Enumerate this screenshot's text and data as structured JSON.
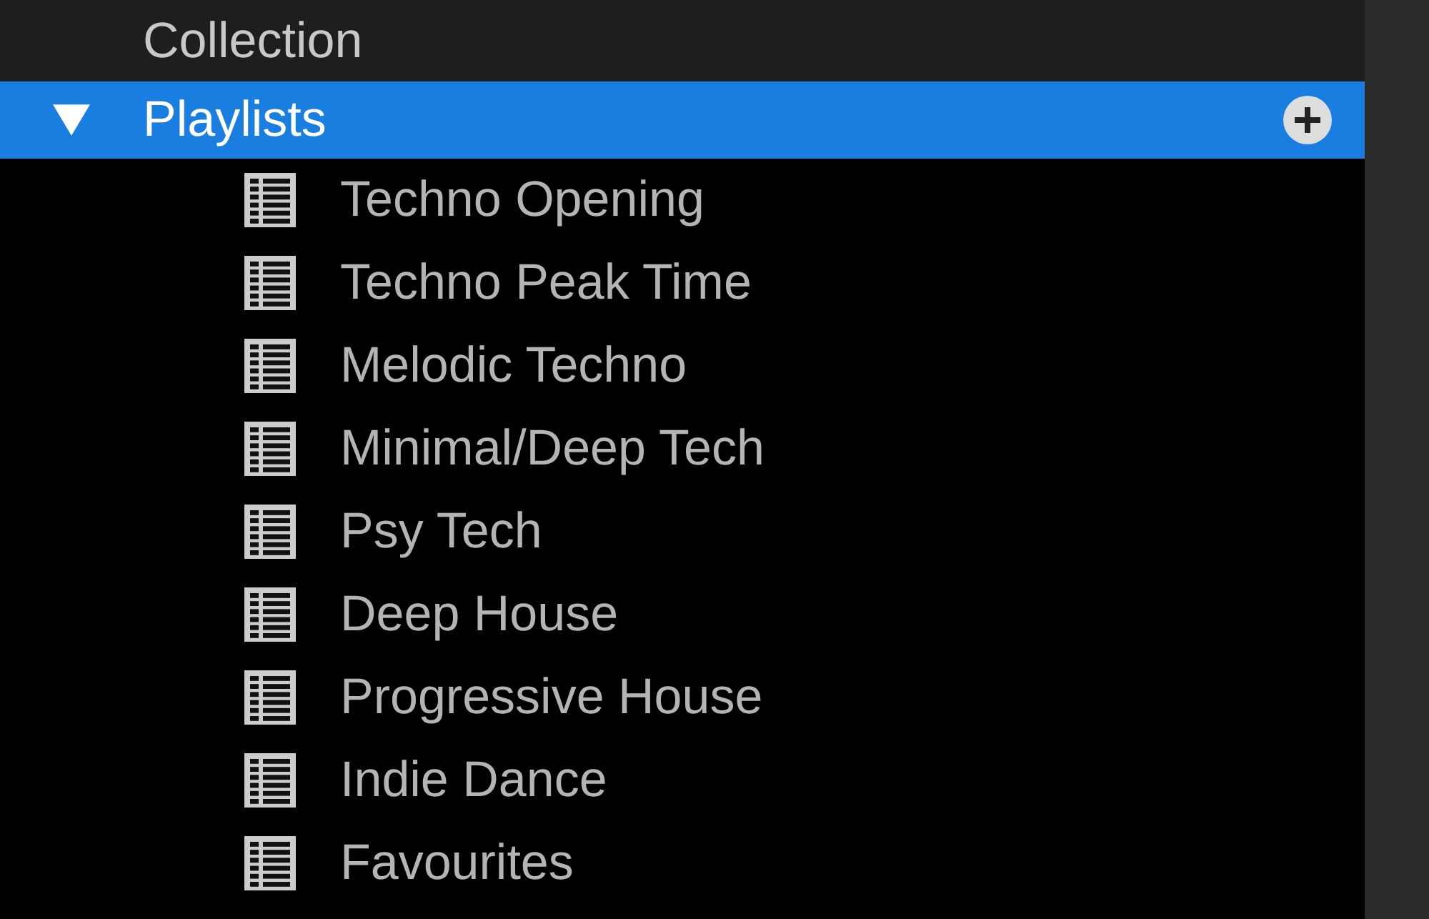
{
  "tree": {
    "items": [
      {
        "label": "Collection",
        "kind": "item",
        "selected": false
      },
      {
        "label": "Playlists",
        "kind": "folder",
        "selected": true,
        "expanded": true,
        "children": [
          {
            "label": "Techno Opening",
            "kind": "playlist",
            "selected": false
          },
          {
            "label": "Techno Peak Time",
            "kind": "playlist",
            "selected": false
          },
          {
            "label": "Melodic Techno",
            "kind": "playlist",
            "selected": false
          },
          {
            "label": "Minimal/Deep Tech",
            "kind": "playlist",
            "selected": false
          },
          {
            "label": "Psy Tech",
            "kind": "playlist",
            "selected": false
          },
          {
            "label": "Deep House",
            "kind": "playlist",
            "selected": false
          },
          {
            "label": "Progressive House",
            "kind": "playlist",
            "selected": false
          },
          {
            "label": "Indie Dance",
            "kind": "playlist",
            "selected": false
          },
          {
            "label": "Favourites",
            "kind": "playlist",
            "selected": false
          }
        ]
      }
    ]
  }
}
